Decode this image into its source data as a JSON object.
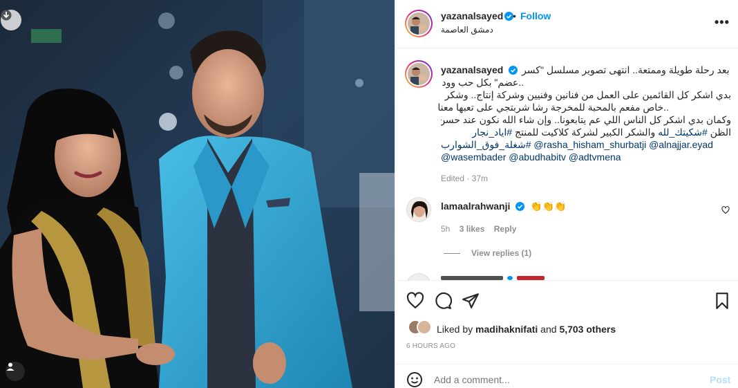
{
  "post": {
    "photo_alt": "",
    "author": {
      "username": "yazanalsayed",
      "follow_label": "Follow",
      "separator": "•",
      "location": "دمشق العاصمة"
    },
    "more_label": "•••",
    "caption": {
      "username": "yazanalsayed",
      "line1": "بعد رحلة طويلة وممتعة.. انتهى تصوير مسلسل \"كسر",
      "line2": "..عضم\" بكل حب وود",
      "line3": "بدي اشكر كل القائمين على العمل من فنانين وفنيين وشركة إنتاج.. وشكر",
      "line4": "..خاص مفعم بالمحبة للمخرجة رشا شربتجي على تعبها معنا",
      "line5": "وكمان بدي اشكر كل الناس اللي عم يتابعونا.. وإن شاء الله نكون عند حسن",
      "line6a": "الظن ",
      "line6b": "#شكيتك_لله",
      "line6c": " والشكر الكبير لشركة كلاكيت للمنتج ",
      "line6d": "#اياد_نجار",
      "line7a": "#شغلة_فوق_الشوارب",
      "line7b": " ",
      "line7c": "@rasha_hisham_shurbatji",
      "line7d": " ",
      "line7e": "@alnajjar.eyad",
      "line8a": "@wasembader",
      "line8b": " ",
      "line8c": "@abudhabitv",
      "line8d": " ",
      "line8e": "@adtvmena",
      "edited": "Edited · 37m"
    },
    "comments": [
      {
        "username": "lamaalrahwanji",
        "text": "👏👏👏",
        "age": "5h",
        "likes": "3 likes",
        "reply_label": "Reply",
        "view_replies": "View replies (1)"
      }
    ],
    "likes_text": {
      "prefix": "Liked by ",
      "user": "madihaknifati",
      "middle": " and ",
      "count": "5,703 others"
    },
    "timestamp": "6 HOURS AGO",
    "comment_placeholder": "Add a comment...",
    "post_label": "Post"
  },
  "icons": {
    "download": "download-icon",
    "tagged": "user-icon",
    "verified": "verified-badge-icon",
    "heart": "heart-icon",
    "comment": "comment-icon",
    "share": "share-icon",
    "save": "bookmark-icon",
    "emoji": "emoji-icon"
  },
  "colors": {
    "accent": "#0095f6",
    "link": "#00376b",
    "muted": "#8e8e8e",
    "jacket": "#2fa3d3",
    "dress_gold": "#c9a545"
  }
}
